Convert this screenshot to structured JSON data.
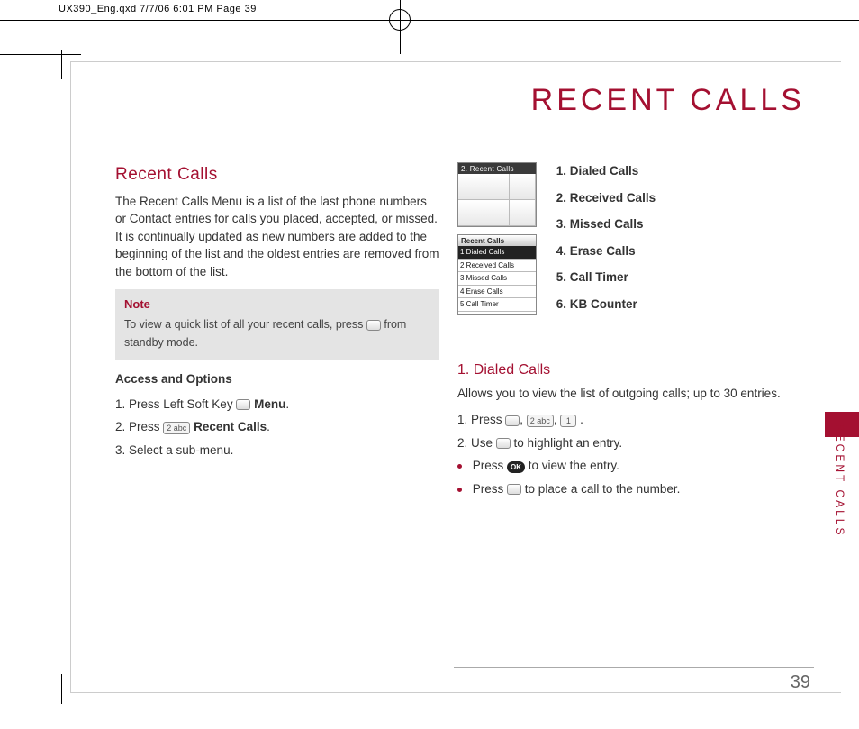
{
  "crop_header": "UX390_Eng.qxd  7/7/06  6:01 PM  Page 39",
  "page_title": "RECENT CALLS",
  "side_label": "RECENT CALLS",
  "page_number": "39",
  "left": {
    "heading": "Recent Calls",
    "intro": "The Recent Calls Menu is a list of the last phone numbers or Contact entries for calls you placed, accepted, or missed. It is continually updated as new numbers are added to the beginning of the list and the oldest entries are removed from the bottom of the list.",
    "note_label": "Note",
    "note_text_a": "To view a quick list of all your recent calls, press ",
    "note_text_b": " from standby mode.",
    "access_heading": "Access and Options",
    "step1_a": "1. Press Left Soft Key ",
    "step1_b": "Menu",
    "step1_c": ".",
    "step2_a": "2. Press ",
    "step2_key": "2 abc",
    "step2_b": "Recent Calls",
    "step2_c": ".",
    "step3": "3. Select a sub-menu."
  },
  "right": {
    "thumb1_title": "2. Recent Calls",
    "thumb2_title": "Recent Calls",
    "thumb2_rows": [
      "1 Dialed Calls",
      "2 Received Calls",
      "3 Missed Calls",
      "4 Erase Calls",
      "5 Call Timer"
    ],
    "menu_items": [
      "1. Dialed Calls",
      "2. Received Calls",
      "3. Missed Calls",
      "4. Erase Calls",
      "5. Call Timer",
      "6. KB Counter"
    ],
    "dialed_heading": "1. Dialed Calls",
    "dialed_intro": "Allows you to view the list of outgoing calls; up to 30 entries.",
    "d_step1_a": "1. Press ",
    "d_step1_k2": "2 abc",
    "d_step1_k1": "1 ",
    "d_step1_end": " .",
    "d_step2_a": "2.   Use ",
    "d_step2_b": " to highlight an entry.",
    "d_b1_a": "Press ",
    "d_b1_ok": "OK",
    "d_b1_b": "  to view the entry.",
    "d_b2_a": "Press ",
    "d_b2_b": "  to place a call to the number."
  }
}
